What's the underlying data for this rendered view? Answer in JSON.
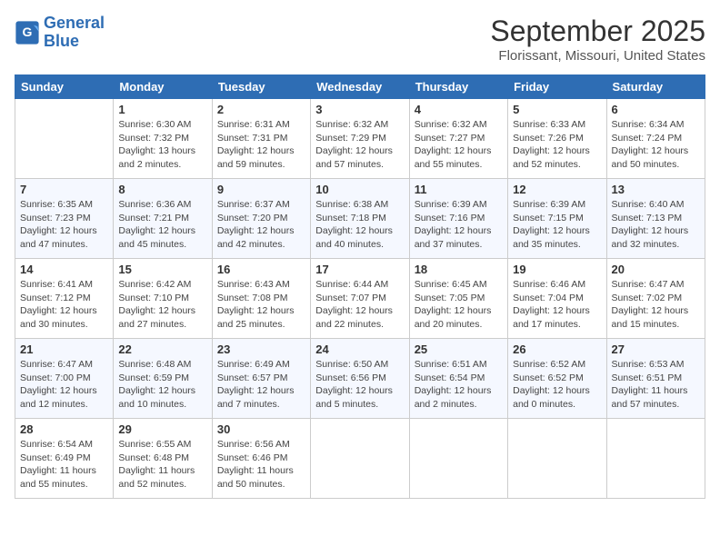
{
  "logo": {
    "line1": "General",
    "line2": "Blue"
  },
  "title": "September 2025",
  "location": "Florissant, Missouri, United States",
  "weekdays": [
    "Sunday",
    "Monday",
    "Tuesday",
    "Wednesday",
    "Thursday",
    "Friday",
    "Saturday"
  ],
  "weeks": [
    [
      {
        "day": "",
        "info": ""
      },
      {
        "day": "1",
        "info": "Sunrise: 6:30 AM\nSunset: 7:32 PM\nDaylight: 13 hours\nand 2 minutes."
      },
      {
        "day": "2",
        "info": "Sunrise: 6:31 AM\nSunset: 7:31 PM\nDaylight: 12 hours\nand 59 minutes."
      },
      {
        "day": "3",
        "info": "Sunrise: 6:32 AM\nSunset: 7:29 PM\nDaylight: 12 hours\nand 57 minutes."
      },
      {
        "day": "4",
        "info": "Sunrise: 6:32 AM\nSunset: 7:27 PM\nDaylight: 12 hours\nand 55 minutes."
      },
      {
        "day": "5",
        "info": "Sunrise: 6:33 AM\nSunset: 7:26 PM\nDaylight: 12 hours\nand 52 minutes."
      },
      {
        "day": "6",
        "info": "Sunrise: 6:34 AM\nSunset: 7:24 PM\nDaylight: 12 hours\nand 50 minutes."
      }
    ],
    [
      {
        "day": "7",
        "info": "Sunrise: 6:35 AM\nSunset: 7:23 PM\nDaylight: 12 hours\nand 47 minutes."
      },
      {
        "day": "8",
        "info": "Sunrise: 6:36 AM\nSunset: 7:21 PM\nDaylight: 12 hours\nand 45 minutes."
      },
      {
        "day": "9",
        "info": "Sunrise: 6:37 AM\nSunset: 7:20 PM\nDaylight: 12 hours\nand 42 minutes."
      },
      {
        "day": "10",
        "info": "Sunrise: 6:38 AM\nSunset: 7:18 PM\nDaylight: 12 hours\nand 40 minutes."
      },
      {
        "day": "11",
        "info": "Sunrise: 6:39 AM\nSunset: 7:16 PM\nDaylight: 12 hours\nand 37 minutes."
      },
      {
        "day": "12",
        "info": "Sunrise: 6:39 AM\nSunset: 7:15 PM\nDaylight: 12 hours\nand 35 minutes."
      },
      {
        "day": "13",
        "info": "Sunrise: 6:40 AM\nSunset: 7:13 PM\nDaylight: 12 hours\nand 32 minutes."
      }
    ],
    [
      {
        "day": "14",
        "info": "Sunrise: 6:41 AM\nSunset: 7:12 PM\nDaylight: 12 hours\nand 30 minutes."
      },
      {
        "day": "15",
        "info": "Sunrise: 6:42 AM\nSunset: 7:10 PM\nDaylight: 12 hours\nand 27 minutes."
      },
      {
        "day": "16",
        "info": "Sunrise: 6:43 AM\nSunset: 7:08 PM\nDaylight: 12 hours\nand 25 minutes."
      },
      {
        "day": "17",
        "info": "Sunrise: 6:44 AM\nSunset: 7:07 PM\nDaylight: 12 hours\nand 22 minutes."
      },
      {
        "day": "18",
        "info": "Sunrise: 6:45 AM\nSunset: 7:05 PM\nDaylight: 12 hours\nand 20 minutes."
      },
      {
        "day": "19",
        "info": "Sunrise: 6:46 AM\nSunset: 7:04 PM\nDaylight: 12 hours\nand 17 minutes."
      },
      {
        "day": "20",
        "info": "Sunrise: 6:47 AM\nSunset: 7:02 PM\nDaylight: 12 hours\nand 15 minutes."
      }
    ],
    [
      {
        "day": "21",
        "info": "Sunrise: 6:47 AM\nSunset: 7:00 PM\nDaylight: 12 hours\nand 12 minutes."
      },
      {
        "day": "22",
        "info": "Sunrise: 6:48 AM\nSunset: 6:59 PM\nDaylight: 12 hours\nand 10 minutes."
      },
      {
        "day": "23",
        "info": "Sunrise: 6:49 AM\nSunset: 6:57 PM\nDaylight: 12 hours\nand 7 minutes."
      },
      {
        "day": "24",
        "info": "Sunrise: 6:50 AM\nSunset: 6:56 PM\nDaylight: 12 hours\nand 5 minutes."
      },
      {
        "day": "25",
        "info": "Sunrise: 6:51 AM\nSunset: 6:54 PM\nDaylight: 12 hours\nand 2 minutes."
      },
      {
        "day": "26",
        "info": "Sunrise: 6:52 AM\nSunset: 6:52 PM\nDaylight: 12 hours\nand 0 minutes."
      },
      {
        "day": "27",
        "info": "Sunrise: 6:53 AM\nSunset: 6:51 PM\nDaylight: 11 hours\nand 57 minutes."
      }
    ],
    [
      {
        "day": "28",
        "info": "Sunrise: 6:54 AM\nSunset: 6:49 PM\nDaylight: 11 hours\nand 55 minutes."
      },
      {
        "day": "29",
        "info": "Sunrise: 6:55 AM\nSunset: 6:48 PM\nDaylight: 11 hours\nand 52 minutes."
      },
      {
        "day": "30",
        "info": "Sunrise: 6:56 AM\nSunset: 6:46 PM\nDaylight: 11 hours\nand 50 minutes."
      },
      {
        "day": "",
        "info": ""
      },
      {
        "day": "",
        "info": ""
      },
      {
        "day": "",
        "info": ""
      },
      {
        "day": "",
        "info": ""
      }
    ]
  ]
}
